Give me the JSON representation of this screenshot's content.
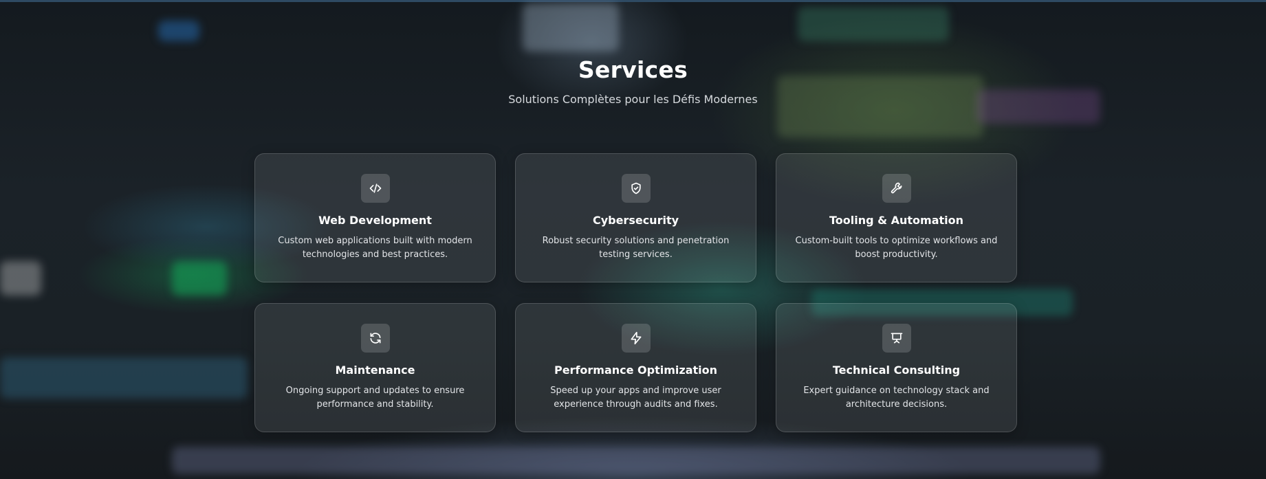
{
  "section": {
    "title": "Services",
    "subtitle": "Solutions Complètes pour les Défis Modernes"
  },
  "services": [
    {
      "icon": "code-icon",
      "title": "Web Development",
      "description": "Custom web applications built with modern technologies and best practices."
    },
    {
      "icon": "shield-check-icon",
      "title": "Cybersecurity",
      "description": "Robust security solutions and penetration testing services."
    },
    {
      "icon": "wrench-icon",
      "title": "Tooling & Automation",
      "description": "Custom-built tools to optimize workflows and boost productivity."
    },
    {
      "icon": "refresh-icon",
      "title": "Maintenance",
      "description": "Ongoing support and updates to ensure performance and stability."
    },
    {
      "icon": "lightning-icon",
      "title": "Performance Optimization",
      "description": "Speed up your apps and improve user experience through audits and fixes."
    },
    {
      "icon": "presentation-icon",
      "title": "Technical Consulting",
      "description": "Expert guidance on technology stack and architecture decisions."
    }
  ]
}
